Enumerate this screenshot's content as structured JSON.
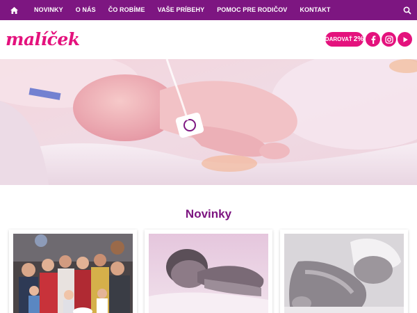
{
  "nav": {
    "home_icon": "home-icon",
    "items": [
      {
        "label": "NOVINKY"
      },
      {
        "label": "O NÁS"
      },
      {
        "label": "ČO ROBÍME"
      },
      {
        "label": "VAŠE PRÍBEHY"
      },
      {
        "label": "POMOC PRE RODIČOV"
      },
      {
        "label": "KONTAKT"
      }
    ],
    "search_icon": "search-icon"
  },
  "header": {
    "logo_text": "malíček",
    "donate_label": "DAROVAŤ",
    "donate_percent": "2%",
    "social": [
      {
        "icon": "facebook-icon"
      },
      {
        "icon": "instagram-icon"
      },
      {
        "icon": "youtube-icon"
      }
    ]
  },
  "hero": {
    "icon": "baby-photo"
  },
  "news": {
    "title": "Novinky",
    "cards": [
      {
        "icon": "family-group-photo"
      },
      {
        "icon": "newborn-photo"
      },
      {
        "icon": "sleeping-baby-photo"
      }
    ]
  },
  "colors": {
    "nav_bg": "#7d1681",
    "brand_pink": "#e4127d",
    "section_title": "#7d1681"
  }
}
